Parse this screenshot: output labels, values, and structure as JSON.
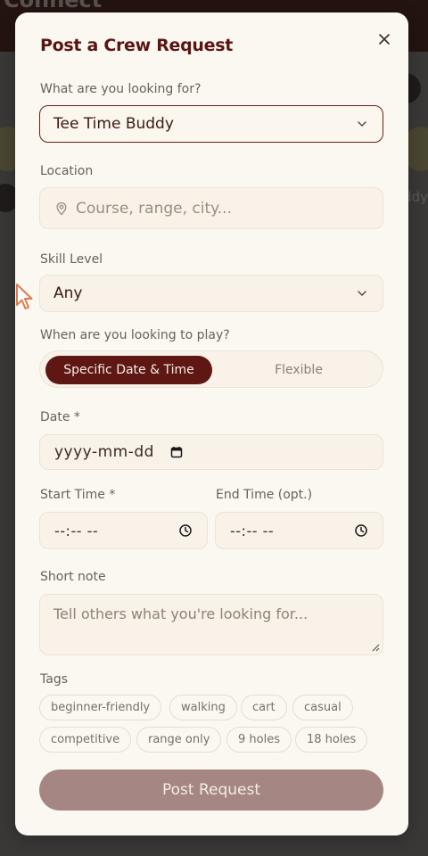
{
  "background": {
    "title": "Connect",
    "right_text": "ddy"
  },
  "modal": {
    "title": "Post a Crew Request",
    "close_icon": "close-icon",
    "looking_for": {
      "label": "What are you looking for?",
      "value": "Tee Time Buddy"
    },
    "location": {
      "label": "Location",
      "placeholder": "Course, range, city..."
    },
    "skill": {
      "label": "Skill Level",
      "value": "Any"
    },
    "when": {
      "label": "When are you looking to play?",
      "options": [
        "Specific Date & Time",
        "Flexible"
      ],
      "selected": "Specific Date & Time"
    },
    "date": {
      "label": "Date *",
      "value": "yyyy-mm-dd"
    },
    "start_time": {
      "label": "Start Time *",
      "value": "--:-- --"
    },
    "end_time": {
      "label": "End Time (opt.)",
      "value": "--:-- --"
    },
    "note": {
      "label": "Short note",
      "placeholder": "Tell others what you're looking for..."
    },
    "tags": {
      "label": "Tags",
      "items": [
        "beginner-friendly",
        "walking",
        "cart",
        "casual",
        "competitive",
        "range only",
        "9 holes",
        "18 holes"
      ]
    },
    "submit_label": "Post Request"
  },
  "colors": {
    "accent": "#5e1713",
    "button_disabled": "#a58682",
    "modal_bg": "#fbf8f2"
  }
}
